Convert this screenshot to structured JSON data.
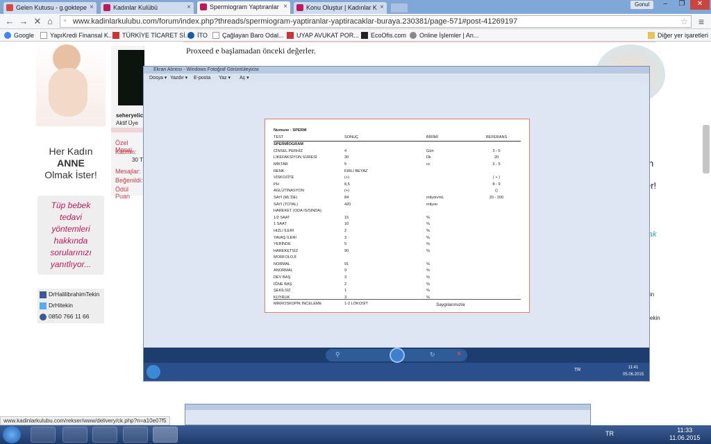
{
  "tabs": [
    {
      "label": "Gelen Kutusu - g.goktepe",
      "color": "#d44"
    },
    {
      "label": "Kadınlar Kulübü",
      "color": "#c2185b"
    },
    {
      "label": "Spermiogram Yaptıranlar",
      "color": "#c2185b"
    },
    {
      "label": "Konu Oluştur | Kadınlar K",
      "color": "#c2185b"
    }
  ],
  "window_user": "Gonul",
  "url": "www.kadinlarkulubu.com/forum/index.php?threads/spermiogram-yaptiranlar-yaptiracaklar-buraya.230381/page-571#post-41269197",
  "bookmarks": [
    "Google",
    "YapıKredi Finansal K...",
    "TÜRKİYE TİCARET Sİ...",
    "İTO",
    "Çağlayan Baro Odal...",
    "UYAP AVUKAT POR...",
    "EcoOfis.com",
    "Online İşlemler | An...",
    "Diğer yer işaretleri"
  ],
  "post_text": "Proxeed e başlamadan önceki değerler.",
  "ad": {
    "line1": "Her Kadın",
    "line2": "ANNE",
    "line3": "Olmak İster!",
    "promo": "Tüp bebek tedavi yöntemleri hakkında sorularınızı yanıtlıyor...",
    "social": [
      "DrHalilibrahimTekin",
      "DrHitekin",
      "0850 766 11 66"
    ]
  },
  "user": {
    "name": "seheryelic",
    "title": "Aktif Üye",
    "fields": [
      "Özel Mesaj",
      "Katılım:",
      "30 T",
      "Mesajlar:",
      "Beğenildi:",
      "Ödül Puan"
    ]
  },
  "right_fragments": [
    "n",
    "er!",
    "ak",
    "in",
    "ekin",
    "ekin"
  ],
  "photo_viewer": {
    "title": "Ekran Alıntısı - Windows Fotoğraf Görüntüleyicisi",
    "menu": [
      "Dosya ▾",
      "Yazdır ▾",
      "E-posta",
      "Yaz ▾",
      "Aç ▾"
    ],
    "clock_time": "11:41",
    "clock_date": "05.06.2015",
    "lang": "TR"
  },
  "report": {
    "sample_label": "Numune :",
    "sample_value": "SPERM",
    "headers": [
      "TEST",
      "SONUÇ",
      "BİRİMİ",
      "REFERANS"
    ],
    "section": "SPERMİOGRAM",
    "rows": [
      [
        "CİNSEL PERHİZ",
        "4",
        "Gün",
        "3 - 5"
      ],
      [
        "LİKEFAKSİYON SÜRESİ",
        "30",
        "Dk",
        "20"
      ],
      [
        "MİKTAR",
        "5",
        "cc",
        "3 - 5"
      ],
      [
        "RENK",
        "KIRLI BEYAZ",
        "",
        ""
      ],
      [
        "VİSKOZİTE",
        "(+)",
        "",
        "( + )"
      ],
      [
        "PH",
        "8,5",
        "",
        "8 - 9"
      ],
      [
        "AGLÜTİNASYON",
        "(+)",
        "",
        "()"
      ],
      [
        "SAYI (ML'DE)",
        "84",
        "milyon/mL",
        "20 - 200"
      ],
      [
        "SAYI (TOTAL)",
        "420",
        "milyon",
        ""
      ],
      [
        "HAREKET (ODA ISISINDA)",
        "",
        "",
        ""
      ],
      [
        "1/2 SAAT",
        "15",
        "%",
        ""
      ],
      [
        "1 SAAT",
        "10",
        "%",
        ""
      ],
      [
        "HIZLI İLERİ",
        "2",
        "%",
        ""
      ],
      [
        "YAVAŞ İLERİ",
        "3",
        "%",
        ""
      ],
      [
        "YERİNDE",
        "5",
        "%",
        ""
      ],
      [
        "HAREKETSİZ",
        "90",
        "%",
        ""
      ],
      [
        "MORFOLOJİ",
        "",
        "",
        ""
      ],
      [
        "NORMAL",
        "91",
        "%",
        ""
      ],
      [
        "ANORMAL",
        "9",
        "%",
        ""
      ],
      [
        "DEV BAŞ",
        "3",
        "%",
        ""
      ],
      [
        "İĞNE BAŞ",
        "2",
        "%",
        ""
      ],
      [
        "ŞEKİLSİZ",
        "1",
        "%",
        ""
      ],
      [
        "KUYRUK",
        "3",
        "%",
        ""
      ],
      [
        "MİKROSKOPİK İNCELEME",
        "1-2 LÖKOSİT",
        "",
        ""
      ]
    ],
    "signature": "Saygılarımızla"
  },
  "status_url": "www.kadinlarkulubu.com/rekser/www/delivery/ck.php?n=a10e07f5",
  "taskbar": {
    "lang": "TR",
    "time": "11:33",
    "date": "11.06.2015"
  }
}
